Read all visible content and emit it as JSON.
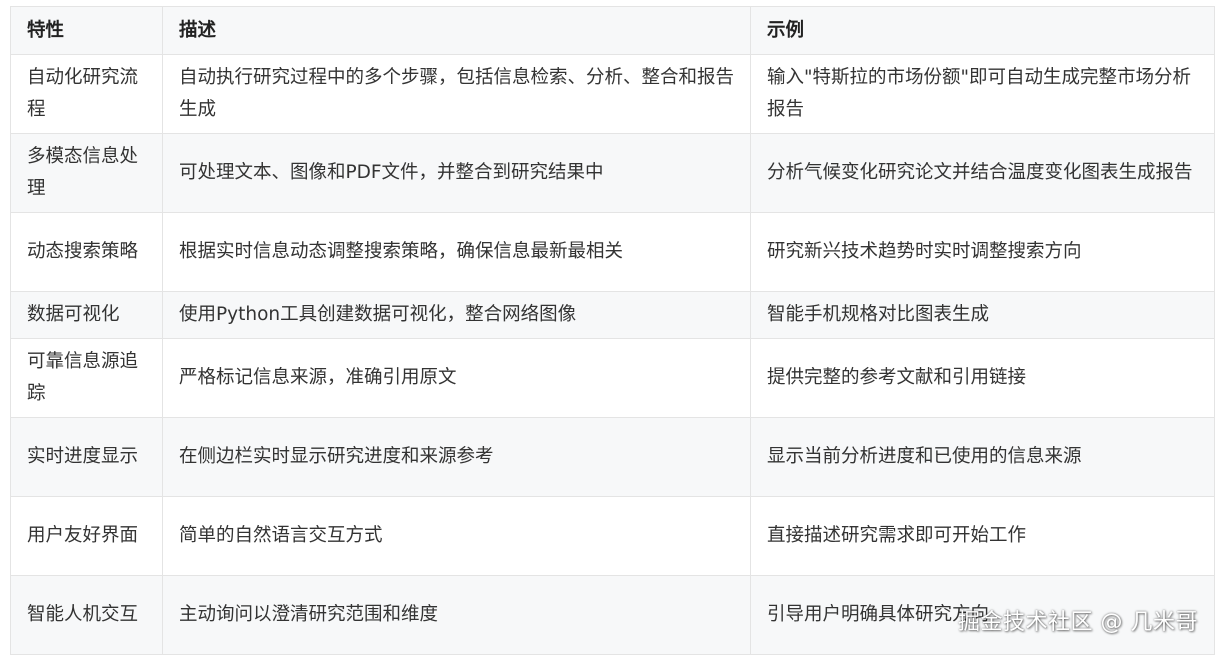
{
  "table": {
    "headers": [
      "特性",
      "描述",
      "示例"
    ],
    "rows": [
      [
        "自动化研究流程",
        "自动执行研究过程中的多个步骤，包括信息检索、分析、整合和报告生成",
        "输入\"特斯拉的市场份额\"即可自动生成完整市场分析报告"
      ],
      [
        "多模态信息处理",
        "可处理文本、图像和PDF文件，并整合到研究结果中",
        "分析气候变化研究论文并结合温度变化图表生成报告"
      ],
      [
        "动态搜索策略",
        "根据实时信息动态调整搜索策略，确保信息最新最相关",
        "研究新兴技术趋势时实时调整搜索方向"
      ],
      [
        "数据可视化",
        "使用Python工具创建数据可视化，整合网络图像",
        "智能手机规格对比图表生成"
      ],
      [
        "可靠信息源追踪",
        "严格标记信息来源，准确引用原文",
        "提供完整的参考文献和引用链接"
      ],
      [
        "实时进度显示",
        "在侧边栏实时显示研究进度和来源参考",
        "显示当前分析进度和已使用的信息来源"
      ],
      [
        "用户友好界面",
        "简单的自然语言交互方式",
        "直接描述研究需求即可开始工作"
      ],
      [
        "智能人机交互",
        "主动询问以澄清研究范围和维度",
        "引导用户明确具体研究方向"
      ]
    ]
  },
  "watermark": "掘金技术社区 @ 几米哥"
}
